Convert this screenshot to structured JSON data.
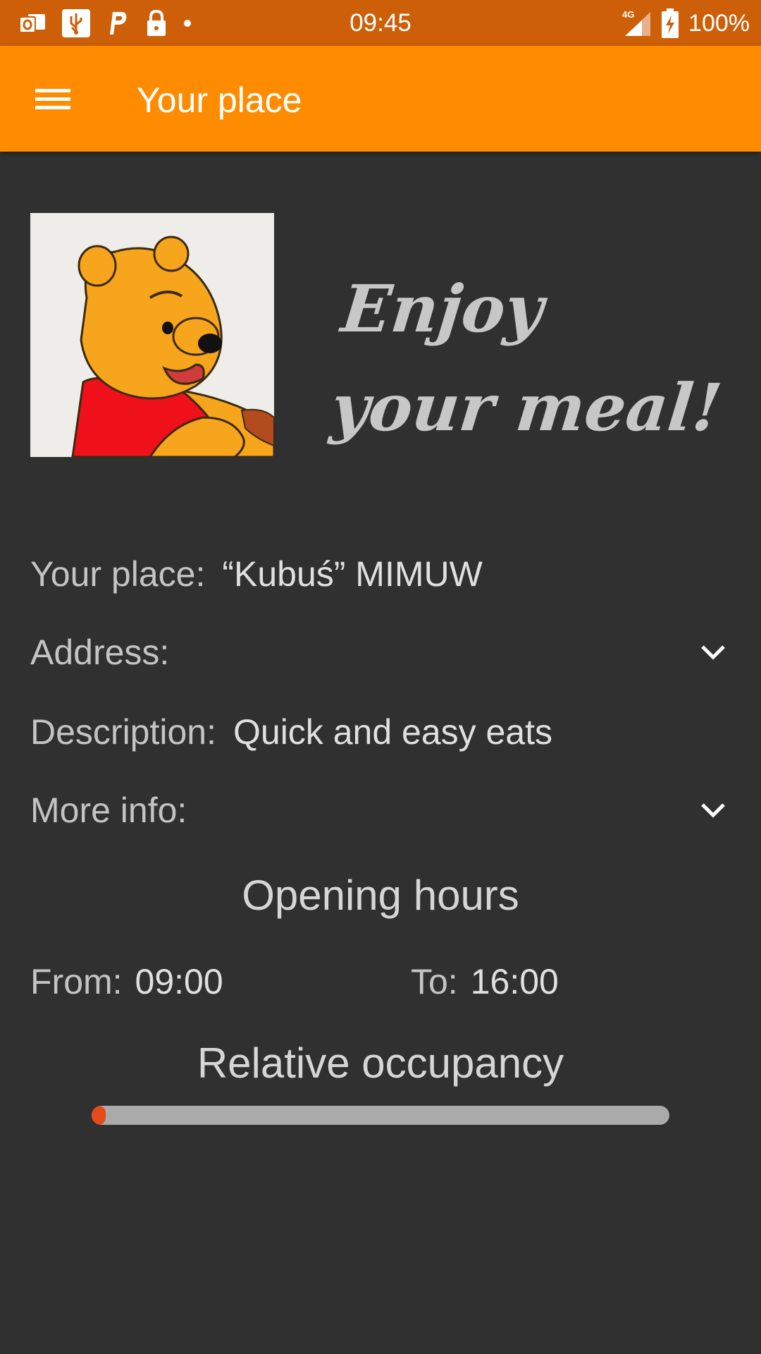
{
  "status_bar": {
    "time": "09:45",
    "battery": "100%",
    "network": "4G",
    "left_icons": [
      "outlook-icon",
      "usb-icon",
      "parking-icon",
      "lock-icon",
      "dot-icon"
    ],
    "color": "#cc5f08"
  },
  "app_bar": {
    "title": "Your place",
    "color": "#ff8c00"
  },
  "hero": {
    "image": "winnie-the-pooh-illustration",
    "tagline_line1": "Enjoy",
    "tagline_line2": "your meal!"
  },
  "info": {
    "place_label": "Your place:",
    "place_value": "“Kubuś” MIMUW",
    "address_label": "Address:",
    "description_label": "Description:",
    "description_value": "Quick and easy eats",
    "more_info_label": "More info:"
  },
  "opening_hours": {
    "title": "Opening hours",
    "from_label": "From:",
    "from_value": "09:00",
    "to_label": "To:",
    "to_value": "16:00"
  },
  "occupancy": {
    "title": "Relative occupancy",
    "fraction": 0.02,
    "fill_color": "#e64a19",
    "track_color": "#aaaaaa"
  }
}
